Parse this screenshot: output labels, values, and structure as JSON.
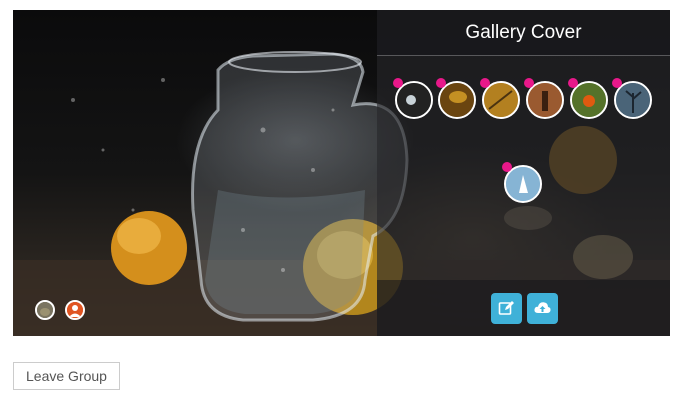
{
  "panel": {
    "title": "Gallery Cover"
  },
  "thumbnails": [
    {
      "icon": "waterdrop-photo-thumb",
      "selected": true
    },
    {
      "icon": "golden-leaf-photo-thumb",
      "selected": true
    },
    {
      "icon": "autumn-branch-photo-thumb",
      "selected": true
    },
    {
      "icon": "figure-photo-thumb",
      "selected": true
    },
    {
      "icon": "orange-berry-photo-thumb",
      "selected": true
    },
    {
      "icon": "blue-tree-photo-thumb",
      "selected": true
    },
    {
      "icon": "dancer-photo-thumb",
      "selected": true
    }
  ],
  "actions": {
    "edit_icon": "edit-icon",
    "upload_icon": "cloud-upload-icon"
  },
  "members": [
    {
      "icon": "member-avatar-cat"
    },
    {
      "icon": "member-avatar-default"
    }
  ],
  "leave_button": {
    "label": "Leave Group"
  }
}
